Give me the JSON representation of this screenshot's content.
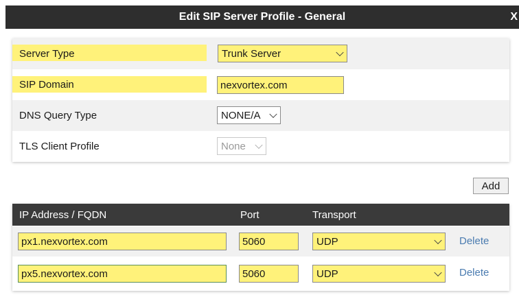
{
  "dialog": {
    "title": "Edit SIP Server Profile - General",
    "close_label": "X"
  },
  "general": {
    "server_type": {
      "label": "Server Type",
      "value": "Trunk Server"
    },
    "sip_domain": {
      "label": "SIP Domain",
      "value": "nexvortex.com"
    },
    "dns_query_type": {
      "label": "DNS Query Type",
      "value": "NONE/A"
    },
    "tls_client_profile": {
      "label": "TLS Client Profile",
      "value": "None"
    }
  },
  "servers": {
    "add_label": "Add",
    "columns": {
      "address": "IP Address / FQDN",
      "port": "Port",
      "transport": "Transport"
    },
    "rows": [
      {
        "address": "px1.nexvortex.com",
        "port": "5060",
        "transport": "UDP",
        "delete_label": "Delete"
      },
      {
        "address": "px5.nexvortex.com",
        "port": "5060",
        "transport": "UDP",
        "delete_label": "Delete"
      }
    ]
  },
  "colors": {
    "title_bar": "#2e2e2e",
    "highlight": "#fff27a",
    "link": "#4a7bb0"
  }
}
